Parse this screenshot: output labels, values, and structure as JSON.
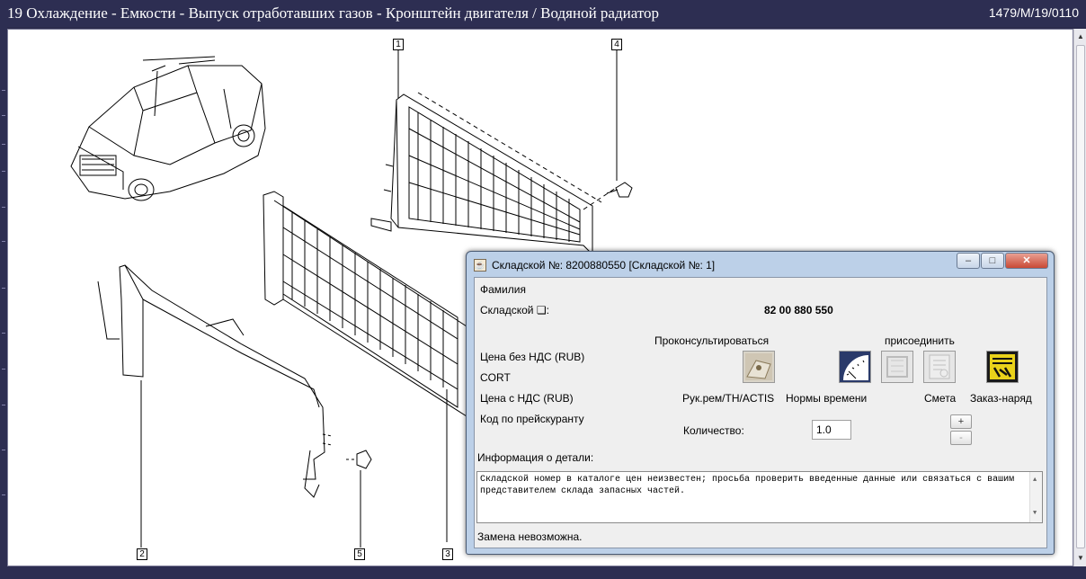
{
  "window": {
    "title": "19 Охлаждение - Емкости - Выпуск отработавших газов - Кронштейн двигателя / Водяной радиатор",
    "ref_code": "1479/M/19/0110"
  },
  "diagram": {
    "callouts": [
      "1",
      "2",
      "3",
      "4",
      "5"
    ]
  },
  "dialog": {
    "title": "Складской №: 8200880550 [Складской №: 1]",
    "window_buttons": {
      "minimize": "–",
      "maximize": "□",
      "close": "✕"
    },
    "family_label": "Фамилия",
    "part_no_label": "Складской ❏:",
    "part_no_value": "82 00 880 550",
    "consult_label": "Проконсультироваться",
    "attach_label": "присоединить",
    "price_excl_vat_label": "Цена без НДС (RUB)",
    "cort_label": "CORT",
    "price_incl_vat_label": "Цена с НДС (RUB)",
    "price_list_code_label": "Код по прейскуранту",
    "icons": {
      "manual": "Рук.рем/TH/ACTIS",
      "labour_times": "Нормы времени",
      "estimate": "Смета",
      "work_order": "Заказ-наряд"
    },
    "quantity_label": "Количество:",
    "quantity_value": "1.0",
    "plus_label": "+",
    "minus_label": "-",
    "info_label": "Информация о детали:",
    "info_text": "Складской номер в каталоге цен неизвестен; просьба проверить введенные данные или связаться с вашим представителем склада запасных частей.",
    "status_text": "Замена невозможна."
  }
}
